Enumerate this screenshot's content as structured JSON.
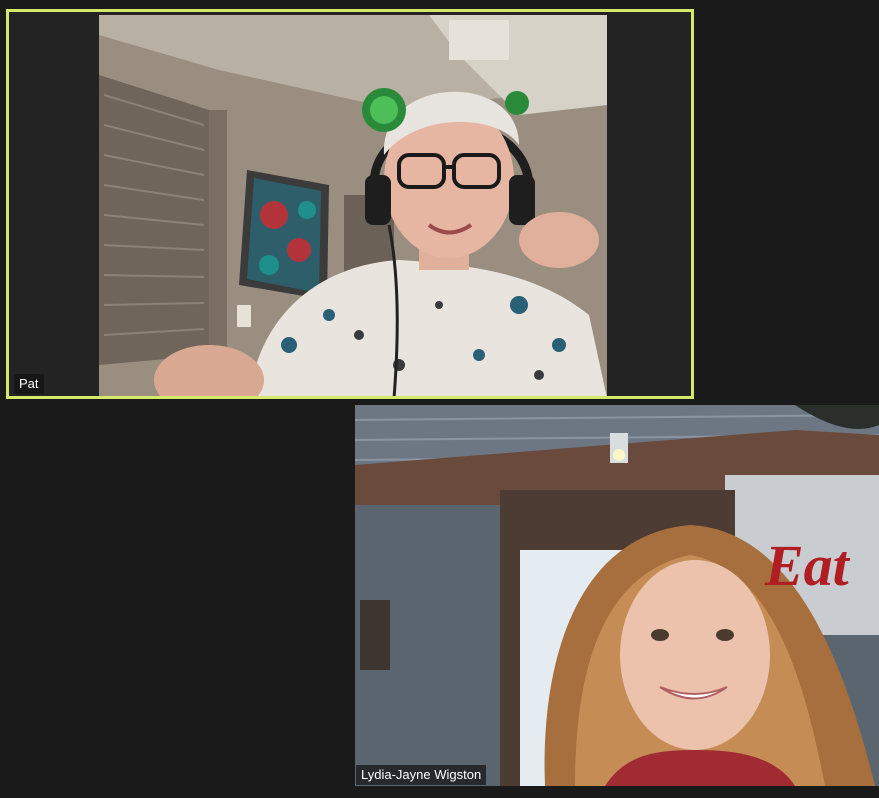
{
  "participants": [
    {
      "name": "Pat",
      "active_speaker": true,
      "highlight_color": "#d4e86a"
    },
    {
      "name": "Lydia-Jayne Wigston",
      "active_speaker": false
    }
  ],
  "background_scene": {
    "sign_text": "Eat"
  },
  "colors": {
    "background": "#1a1a1a",
    "tile_background": "#232323",
    "active_border": "#d4e86a",
    "name_tag_text": "#ffffff"
  }
}
